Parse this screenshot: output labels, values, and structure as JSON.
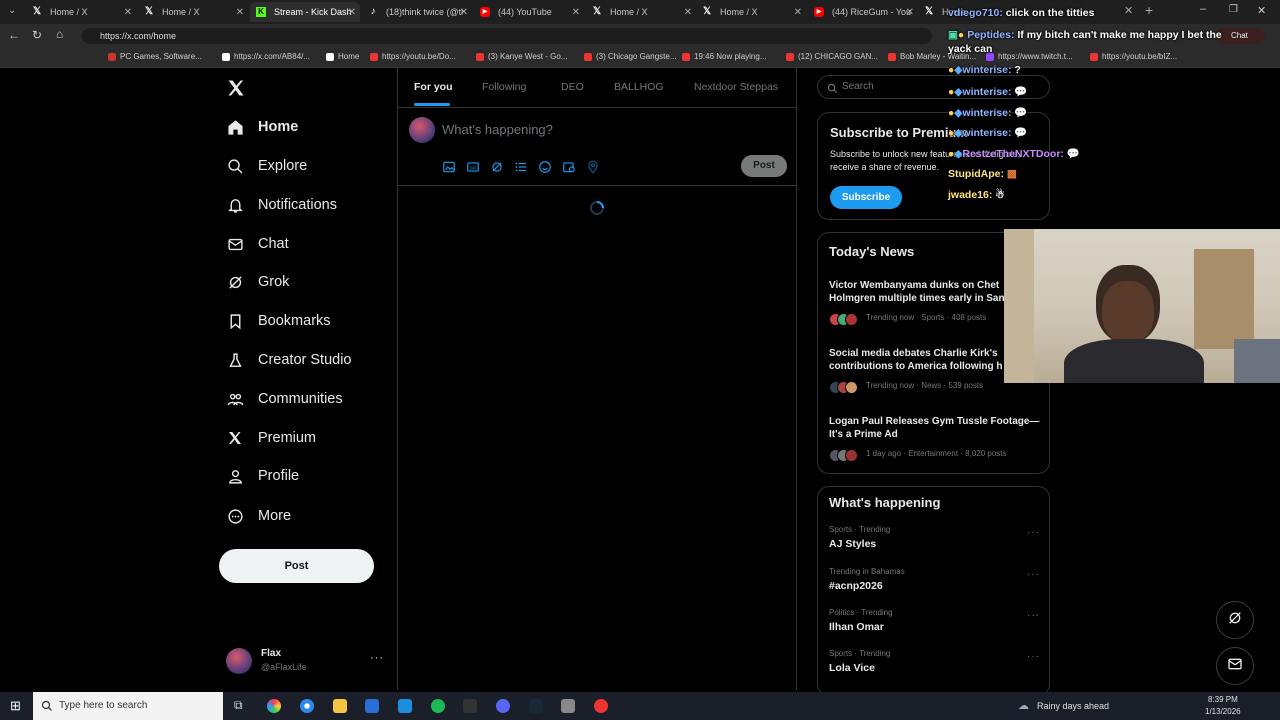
{
  "browser": {
    "tabs": [
      {
        "label": "Home / X",
        "icon": "x-logo"
      },
      {
        "label": "Home / X",
        "icon": "x-logo"
      },
      {
        "label": "Stream - Kick Dash",
        "icon": "kick-logo"
      },
      {
        "label": "(18)think twice (@ti",
        "icon": "tiktok-logo"
      },
      {
        "label": "(44) YouTube",
        "icon": "youtube-logo"
      },
      {
        "label": "Home / X",
        "icon": "x-logo"
      },
      {
        "label": "Home / X",
        "icon": "x-logo"
      },
      {
        "label": "(44) RiceGum - You",
        "icon": "youtube-logo"
      },
      {
        "label": "Home",
        "icon": "x-logo"
      }
    ],
    "url": "https://x.com/home",
    "bookmarks": [
      "PC Games, Software...",
      "https://x.com/AB84/...",
      "Home",
      "https://youtu.be/Do...",
      "(3) Kanye West - Go...",
      "(3) Chicago Gangste...",
      "19:46 Now playing...",
      "(12) CHICAGO GAN...",
      "Bob Marley - Waitin...",
      "https://www.twitch.t...",
      "https://youtu.be/bIZ..."
    ]
  },
  "sidebar": {
    "items": [
      {
        "label": "Home",
        "icon": "home-icon"
      },
      {
        "label": "Explore",
        "icon": "search-icon"
      },
      {
        "label": "Notifications",
        "icon": "bell-icon"
      },
      {
        "label": "Chat",
        "icon": "mail-icon"
      },
      {
        "label": "Grok",
        "icon": "grok-icon"
      },
      {
        "label": "Bookmarks",
        "icon": "bookmark-icon"
      },
      {
        "label": "Creator Studio",
        "icon": "flask-icon"
      },
      {
        "label": "Communities",
        "icon": "people-icon"
      },
      {
        "label": "Premium",
        "icon": "x-logo-icon"
      },
      {
        "label": "Profile",
        "icon": "person-icon"
      },
      {
        "label": "More",
        "icon": "more-circle-icon"
      }
    ],
    "post_label": "Post",
    "account": {
      "name": "Flax",
      "handle": "@aFlaxLife"
    }
  },
  "feed": {
    "tabs": [
      "For you",
      "Following",
      "DEO",
      "BALLHOG",
      "Nextdoor Steppas"
    ],
    "composer_placeholder": "What's happening?",
    "post_label": "Post"
  },
  "right": {
    "search_placeholder": "Search",
    "subscribe": {
      "title": "Subscribe to Premium",
      "text": "Subscribe to unlock new features and if eligible, receive a share of revenue.",
      "button": "Subscribe"
    },
    "news_title": "Today's News",
    "news": [
      {
        "title": "Victor Wembanyama dunks on Chet Holmgren multiple times early in San",
        "meta": "Trending now · Sports · 408 posts"
      },
      {
        "title": "Social media debates Charlie Kirk's contributions to America following h",
        "meta": "Trending now · News · 539 posts"
      },
      {
        "title": "Logan Paul Releases Gym Tussle Footage—It's a Prime Ad",
        "meta": "1 day ago · Entertainment · 8,020 posts"
      }
    ],
    "happening_title": "What's happening",
    "trends": [
      {
        "category": "Sports · Trending",
        "name": "AJ Styles"
      },
      {
        "category": "Trending in Bahamas",
        "name": "#acnp2026"
      },
      {
        "category": "Politics · Trending",
        "name": "Ilhan Omar"
      },
      {
        "category": "Sports · Trending",
        "name": "Lola Vice"
      }
    ]
  },
  "chat_overlay": [
    {
      "user": "vdiego710:",
      "msg": "click on the titties"
    },
    {
      "user": "Peptides:",
      "msg": "If my bitch can't make me happy I bet the yack can"
    },
    {
      "user": "winterise:",
      "msg": "?"
    },
    {
      "user": "winterise:",
      "msg": ""
    },
    {
      "user": "winterise:",
      "msg": ""
    },
    {
      "user": "winterise:",
      "msg": ""
    },
    {
      "user": "RestzeTheNXTDoor:",
      "msg": ""
    },
    {
      "user": "StupidApe:",
      "msg": ""
    },
    {
      "user": "jwade16:",
      "msg": ""
    }
  ],
  "taskbar": {
    "search_placeholder": "Type here to search",
    "weather": "Rainy days ahead",
    "time": "8:39 PM",
    "date": "1/13/2026"
  },
  "colors": {
    "accent": "#1d9bf0",
    "background": "#000000",
    "border": "#2f3336",
    "muted": "#71767b"
  }
}
